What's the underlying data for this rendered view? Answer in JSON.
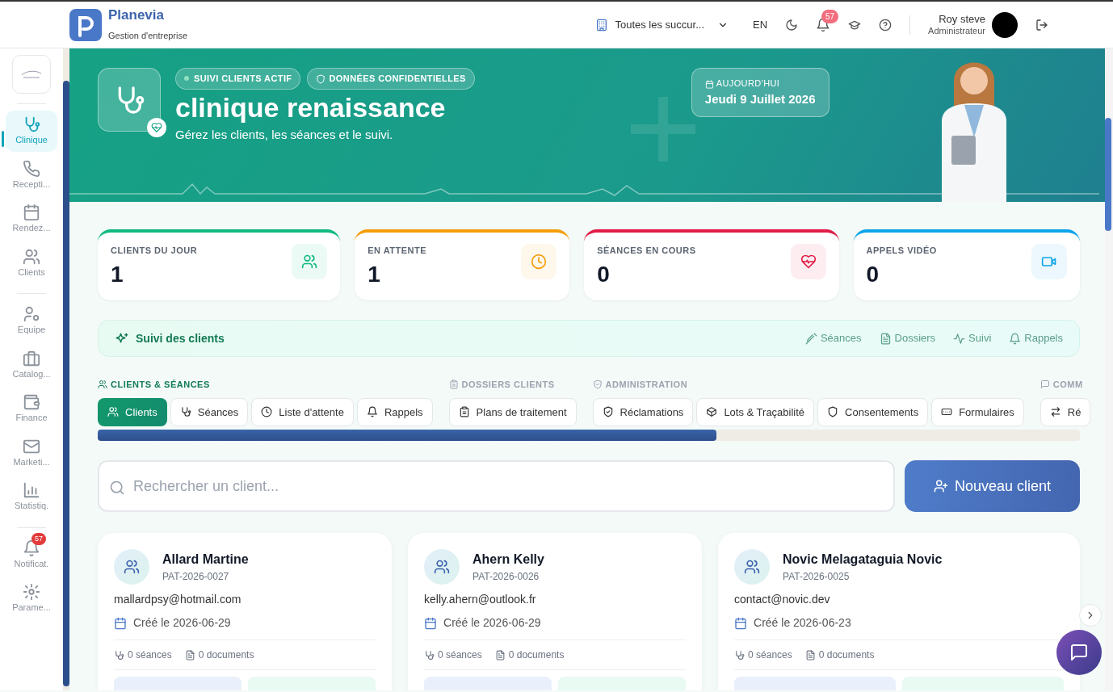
{
  "topbar": {
    "brand": "Planevia",
    "subtitle": "Gestion d'entreprise",
    "branch": "Toutes les succur...",
    "language": "EN",
    "notifications": "57",
    "user": {
      "name": "Roy steve",
      "role": "Administrateur"
    }
  },
  "sidebar": {
    "groups": [
      {
        "items": [
          {
            "label": "Clinique",
            "selected": true
          },
          {
            "label": "Recepti...",
            "selected": false
          },
          {
            "label": "Rendez...",
            "selected": false
          },
          {
            "label": "Clients",
            "selected": false
          }
        ]
      },
      {
        "items": [
          {
            "label": "Equipe",
            "selected": false
          },
          {
            "label": "Catalog...",
            "selected": false
          },
          {
            "label": "Finance",
            "selected": false
          },
          {
            "label": "Marketi...",
            "selected": false
          },
          {
            "label": "Statistiq.",
            "selected": false
          }
        ]
      },
      {
        "items": [
          {
            "label": "Notificat.",
            "selected": false,
            "badge": "57"
          },
          {
            "label": "Parame...",
            "selected": false
          }
        ]
      }
    ]
  },
  "hero": {
    "badges": [
      {
        "text": "SUIVI CLIENTS ACTIF",
        "kind": "dot"
      },
      {
        "text": "DONNÉES CONFIDENTIELLES",
        "kind": "shield"
      }
    ],
    "title": "clinique renaissance",
    "subtitle": "Gérez les clients, les séances et le suivi.",
    "date_label": "AUJOURD'HUI",
    "date": "Jeudi 9 Juillet 2026"
  },
  "stats": [
    {
      "label": "CLIENTS DU JOUR",
      "value": "1",
      "color": "#10b981"
    },
    {
      "label": "EN ATTENTE",
      "value": "1",
      "color": "#f59e0b"
    },
    {
      "label": "SÉANCES EN COURS",
      "value": "0",
      "color": "#e11d48"
    },
    {
      "label": "APPELS VIDÉO",
      "value": "0",
      "color": "#0ea5e9"
    }
  ],
  "followup": {
    "title": "Suivi des clients",
    "links": [
      "Séances",
      "Dossiers",
      "Suivi",
      "Rappels"
    ]
  },
  "tab_groups": [
    {
      "label": "CLIENTS & SÉANCES",
      "active": true,
      "tabs": [
        {
          "label": "Clients",
          "selected": true
        },
        {
          "label": "Séances",
          "selected": false
        },
        {
          "label": "Liste d'attente",
          "selected": false
        },
        {
          "label": "Rappels",
          "selected": false
        }
      ]
    },
    {
      "label": "DOSSIERS CLIENTS",
      "active": false,
      "tabs": [
        {
          "label": "Plans de traitement",
          "selected": false
        }
      ]
    },
    {
      "label": "ADMINISTRATION",
      "active": false,
      "tabs": [
        {
          "label": "Réclamations",
          "selected": false
        },
        {
          "label": "Lots & Traçabilité",
          "selected": false
        },
        {
          "label": "Consentements",
          "selected": false
        },
        {
          "label": "Formulaires",
          "selected": false
        }
      ]
    },
    {
      "label": "COMM",
      "active": false,
      "tabs": [
        {
          "label": "Ré",
          "selected": false
        }
      ]
    }
  ],
  "search": {
    "placeholder": "Rechercher un client..."
  },
  "new_button": "Nouveau client",
  "clients": [
    {
      "name": "Allard Martine",
      "code": "PAT-2026-0027",
      "email": "mallardpsy@hotmail.com",
      "created": "Créé le 2026-06-29",
      "sessions": "0 séances",
      "documents": "0 documents"
    },
    {
      "name": "Ahern Kelly",
      "code": "PAT-2026-0026",
      "email": "kelly.ahern@outlook.fr",
      "created": "Créé le 2026-06-29",
      "sessions": "0 séances",
      "documents": "0 documents"
    },
    {
      "name": "Novic Melagataguia Novic",
      "code": "PAT-2026-0025",
      "email": "contact@novic.dev",
      "created": "Créé le 2026-06-23",
      "sessions": "0 séances",
      "documents": "0 documents"
    }
  ]
}
